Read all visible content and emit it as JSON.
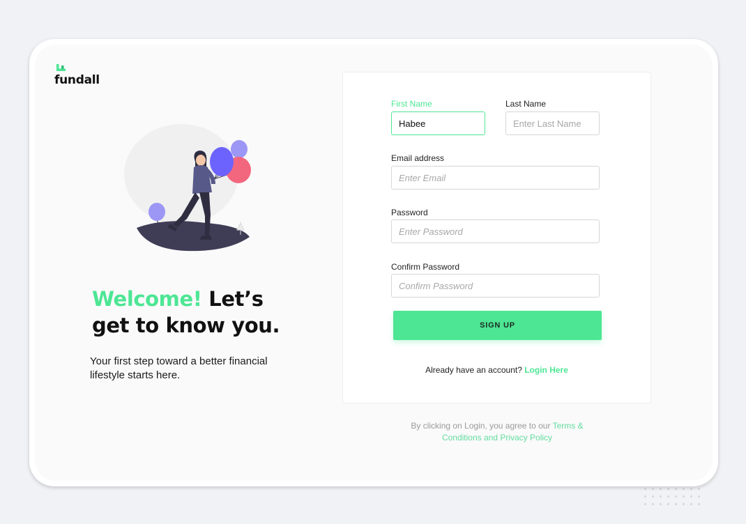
{
  "brand": {
    "name": "fundall",
    "accent": "#4de694"
  },
  "hero": {
    "headline_accent": "Welcome!",
    "headline_rest": " Let’s get to know you.",
    "subtitle": "Your first step toward a better financial lifestyle starts here."
  },
  "form": {
    "first_name": {
      "label": "First Name",
      "value": "Habee",
      "placeholder": ""
    },
    "last_name": {
      "label": "Last Name",
      "placeholder": "Enter Last Name"
    },
    "email": {
      "label": "Email address",
      "placeholder": "Enter Email"
    },
    "password": {
      "label": "Password",
      "placeholder": "Enter Password"
    },
    "confirm_password": {
      "label": "Confirm Password",
      "placeholder": "Confirm Password"
    },
    "submit_label": "SIGN UP"
  },
  "login_prompt": {
    "text": "Already have an account? ",
    "link": "Login Here"
  },
  "terms": {
    "text": "By clicking on Login, you agree to our ",
    "link": "Terms & Conditions and Privacy Policy"
  },
  "icons": [
    "fundall-logo-icon",
    "woman-with-balloons-illustration"
  ]
}
